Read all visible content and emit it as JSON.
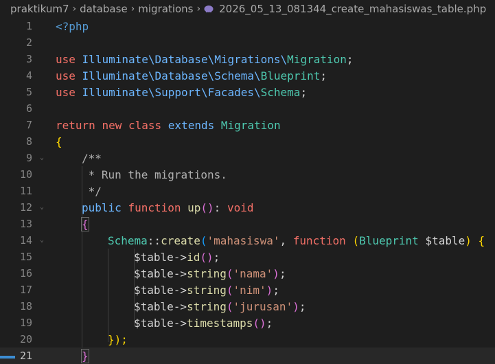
{
  "breadcrumb": {
    "items": [
      "praktikum7",
      "database",
      "migrations"
    ],
    "file": "2026_05_13_081344_create_mahasiswas_table.php",
    "file_icon": "php-elephant-icon"
  },
  "editor": {
    "current_line": 21,
    "lines": [
      {
        "n": "1"
      },
      {
        "n": "2"
      },
      {
        "n": "3"
      },
      {
        "n": "4"
      },
      {
        "n": "5"
      },
      {
        "n": "6"
      },
      {
        "n": "7"
      },
      {
        "n": "8"
      },
      {
        "n": "9"
      },
      {
        "n": "10"
      },
      {
        "n": "11"
      },
      {
        "n": "12"
      },
      {
        "n": "13"
      },
      {
        "n": "14"
      },
      {
        "n": "15"
      },
      {
        "n": "16"
      },
      {
        "n": "17"
      },
      {
        "n": "18"
      },
      {
        "n": "19"
      },
      {
        "n": "20"
      },
      {
        "n": "21"
      }
    ],
    "tokens": {
      "l1_php": "<?php",
      "use": "use",
      "l3_ns": "Illuminate\\Database\\Migrations\\",
      "l3_cls": "Migration",
      "l4_ns": "Illuminate\\Database\\Schema\\",
      "l4_cls": "Blueprint",
      "l5_ns": "Illuminate\\Support\\Facades\\",
      "l5_cls": "Schema",
      "semi": ";",
      "return": "return",
      "new": "new",
      "class": "class",
      "extends": "extends",
      "l7_cls": "Migration",
      "open_brace": "{",
      "close_brace": "}",
      "c1": "/**",
      "c2": " * Run the migrations.",
      "c3": " */",
      "public": "public",
      "function": "function",
      "up": "up",
      "parens": "()",
      "colon": ":",
      "void": "void",
      "schema": "Schema",
      "dcolon": "::",
      "create": "create",
      "paren_open": "(",
      "paren_close": ")",
      "str_mahasiswa": "'mahasiswa'",
      "comma": ",",
      "blueprint": "Blueprint",
      "var_table": "$table",
      "arrow": "->",
      "id": "id",
      "string": "string",
      "str_nama": "'nama'",
      "str_nim": "'nim'",
      "str_jurusan": "'jurusan'",
      "timestamps": "timestamps",
      "close_l20": "});"
    }
  },
  "colors": {
    "background": "#1e1e1e",
    "keyword": "#f47067",
    "namespace": "#6cb6ff",
    "class": "#4ec9b0",
    "string": "#ce9178",
    "method": "#dcdcaa",
    "brace_gold": "#ffd700",
    "brace_purple": "#da70d6",
    "brace_blue": "#179fff"
  }
}
